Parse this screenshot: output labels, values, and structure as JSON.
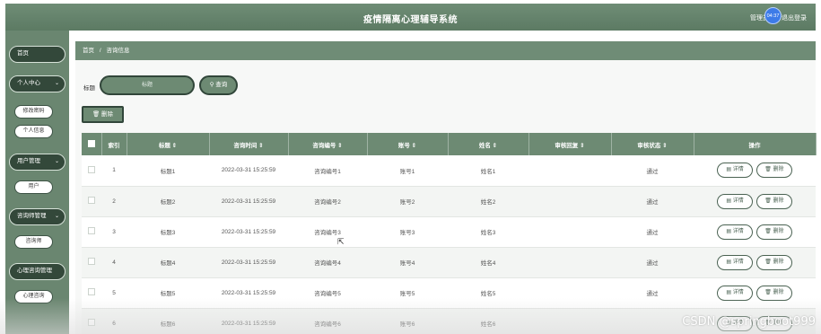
{
  "header": {
    "title": "疫情隔离心理辅导系统",
    "user_label": "管理员",
    "logout_label": "退出登录",
    "clock": "04:37"
  },
  "sidebar": {
    "items": [
      {
        "label": "首页"
      },
      {
        "label": "个人中心",
        "chevron": "chevron-down-icon",
        "children": [
          {
            "label": "修改密码"
          },
          {
            "label": "个人信息"
          }
        ]
      },
      {
        "label": "用户管理",
        "chevron": "chevron-down-icon",
        "children": [
          {
            "label": "用户"
          }
        ]
      },
      {
        "label": "咨询师管理",
        "chevron": "chevron-down-icon",
        "children": [
          {
            "label": "咨询师"
          }
        ]
      },
      {
        "label": "心理咨询管理",
        "children": [
          {
            "label": "心理咨询"
          }
        ]
      }
    ]
  },
  "breadcrumb": {
    "home": "首页",
    "separator": "/",
    "current": "咨询信息"
  },
  "search": {
    "label": "标题",
    "placeholder": "标题",
    "button_label": "查询"
  },
  "toolbar": {
    "delete_label": "删除"
  },
  "table": {
    "columns": [
      "索引",
      "标题 ⇕",
      "咨询时间 ⇕",
      "咨询编号 ⇕",
      "账号 ⇕",
      "姓名 ⇕",
      "审核回复 ⇕",
      "审核状态 ⇕",
      "操作"
    ],
    "rows": [
      {
        "index": "1",
        "title": "标题1",
        "time": "2022-03-31 15:25:59",
        "code": "咨询编号1",
        "account": "账号1",
        "name": "姓名1",
        "reply": "",
        "status": "通过"
      },
      {
        "index": "2",
        "title": "标题2",
        "time": "2022-03-31 15:25:59",
        "code": "咨询编号2",
        "account": "账号2",
        "name": "姓名2",
        "reply": "",
        "status": "通过"
      },
      {
        "index": "3",
        "title": "标题3",
        "time": "2022-03-31 15:25:59",
        "code": "咨询编号3",
        "account": "账号3",
        "name": "姓名3",
        "reply": "",
        "status": "通过"
      },
      {
        "index": "4",
        "title": "标题4",
        "time": "2022-03-31 15:25:59",
        "code": "咨询编号4",
        "account": "账号4",
        "name": "姓名4",
        "reply": "",
        "status": "通过"
      },
      {
        "index": "5",
        "title": "标题5",
        "time": "2022-03-31 15:25:59",
        "code": "咨询编号5",
        "account": "账号5",
        "name": "姓名5",
        "reply": "",
        "status": "通过"
      },
      {
        "index": "6",
        "title": "标题6",
        "time": "2022-03-31 15:25:59",
        "code": "咨询编号6",
        "account": "账号6",
        "name": "姓名6",
        "reply": "",
        "status": ""
      }
    ],
    "detail_label": "详情",
    "delete_label": "删除"
  },
  "watermark": "CSDN @springboot999",
  "colors": {
    "primary": "#6d8a73",
    "dark": "#31463a",
    "clock": "#3d7be8"
  }
}
